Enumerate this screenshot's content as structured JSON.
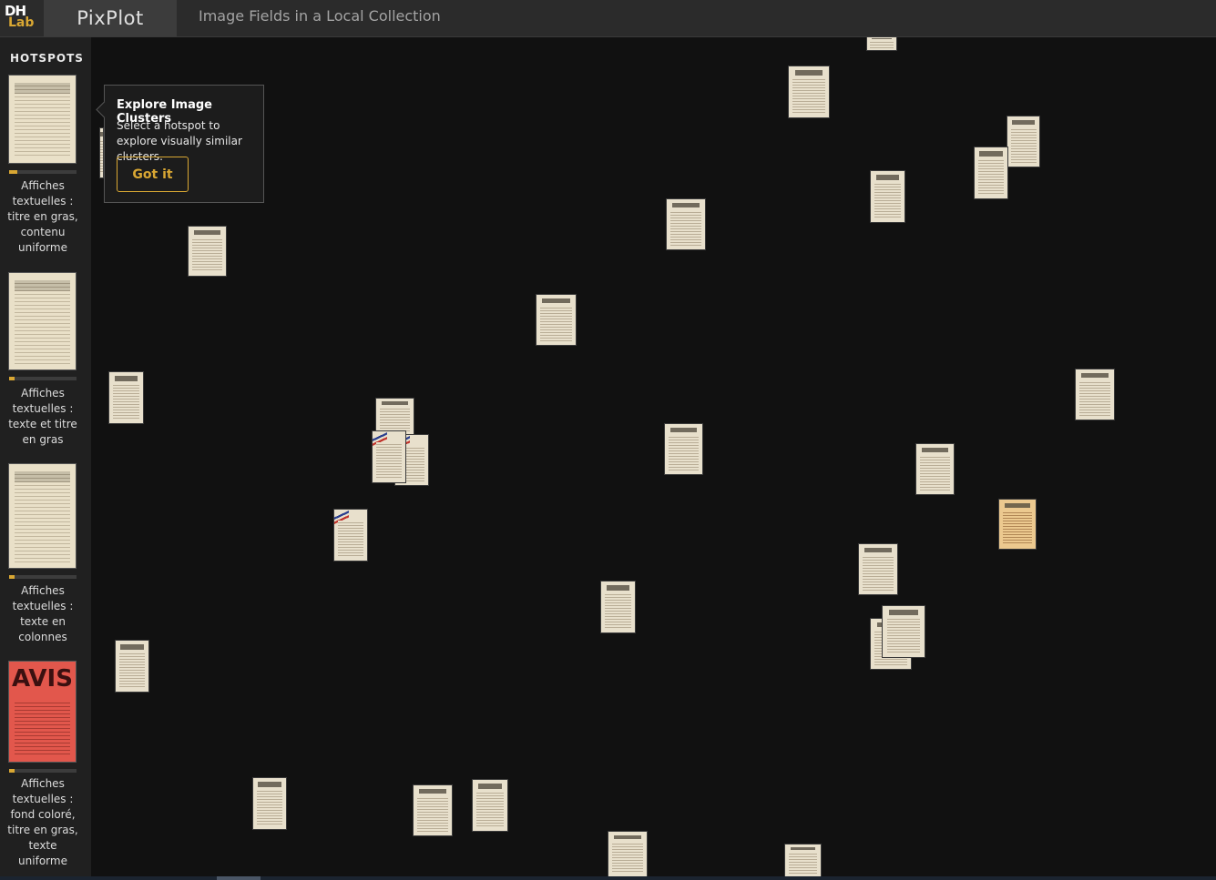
{
  "header": {
    "logo_line1": "DH",
    "logo_line2": "Lab",
    "brand": "PixPlot",
    "subtitle": "Image Fields in a Local Collection"
  },
  "sidebar": {
    "title": "HOTSPOTS",
    "hotspots": [
      {
        "label": "Affiches textuelles : titre en gras, contenu uniforme",
        "thumb_text": "AVIS A LA POPULATION",
        "fill": 0.12
      },
      {
        "label": "Affiches textuelles : texte et titre en gras",
        "thumb_text": "Neueste Nachrichten",
        "fill": 0.08
      },
      {
        "label": "Affiches textuelles : texte en colonnes",
        "thumb_text": "Verordnung",
        "fill": 0.08
      },
      {
        "label": "Affiches textuelles : fond coloré, titre en gras, texte uniforme",
        "thumb_text": "AVIS",
        "fill": 0.08
      }
    ]
  },
  "tooltip": {
    "title": "Explore Image Clusters",
    "body": "Select a hotspot to explore visually similar clusters.",
    "button": "Got it"
  },
  "colors": {
    "accent": "#d9a733",
    "header_bg": "#2b2b2b",
    "canvas_bg": "#111111",
    "hotspot4_bg": "#e2574c"
  }
}
